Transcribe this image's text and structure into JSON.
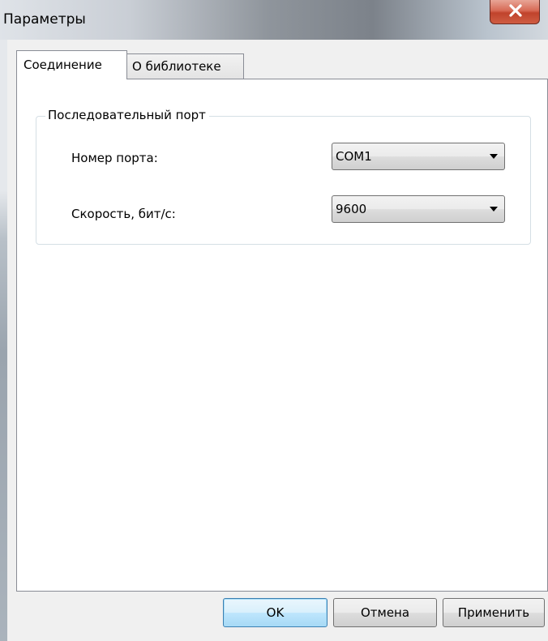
{
  "window": {
    "title": "Параметры",
    "close_icon": "close-icon"
  },
  "tabs": [
    {
      "label": "Соединение",
      "active": true
    },
    {
      "label": "О библиотеке",
      "active": false
    }
  ],
  "serial_port": {
    "group_title": "Последовательный порт",
    "port_label": "Номер порта:",
    "port_value": "COM1",
    "speed_label": "Скорость, бит/с:",
    "speed_value": "9600"
  },
  "buttons": {
    "ok": "OK",
    "cancel": "Отмена",
    "apply": "Применить"
  },
  "colors": {
    "close_button": "#c0432c",
    "default_button_border": "#3c7fb1",
    "group_border": "#d5dfe5"
  }
}
